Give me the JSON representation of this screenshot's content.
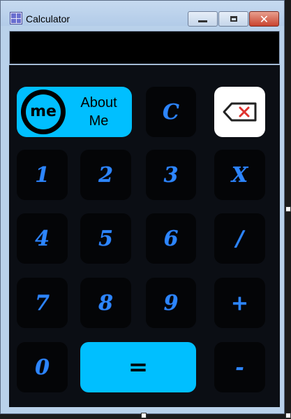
{
  "window": {
    "title": "Calculator",
    "minimize_label": "",
    "maximize_label": "",
    "close_label": "✕"
  },
  "display": {
    "value": ""
  },
  "keys": {
    "about_label": "About\nMe",
    "about_logo_text": "me",
    "clear": "C",
    "one": "1",
    "two": "2",
    "three": "3",
    "multiply": "X",
    "four": "4",
    "five": "5",
    "six": "6",
    "divide": "/",
    "seven": "7",
    "eight": "8",
    "nine": "9",
    "plus": "+",
    "zero": "0",
    "equals": "=",
    "minus": "-"
  },
  "colors": {
    "accent": "#00bfff",
    "key_text": "#2d86ff",
    "keypad_bg": "#0b0e14",
    "backspace_x": "#e0332f"
  },
  "icons": {
    "app": "calculator-grid-icon",
    "backspace": "backspace-icon",
    "about_logo": "me-smiley-logo-icon"
  }
}
